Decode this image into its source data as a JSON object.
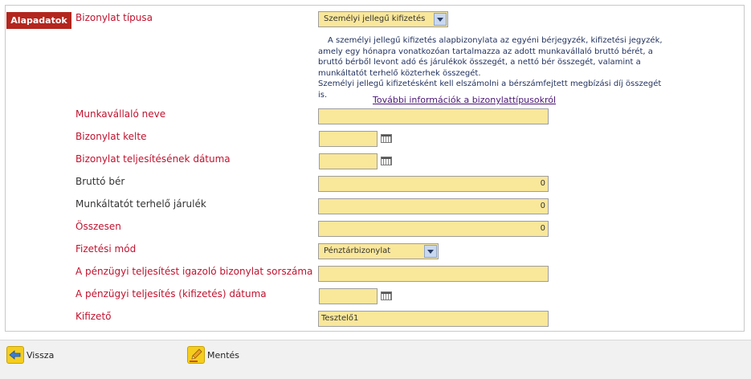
{
  "tab": {
    "label": "Alapadatok"
  },
  "fields": {
    "type": {
      "label": "Bizonylat típusa",
      "value": "Személyi jellegű kifizetés"
    },
    "employee": {
      "label": "Munkavállaló neve",
      "value": ""
    },
    "date": {
      "label": "Bizonylat kelte",
      "value": ""
    },
    "completion_date": {
      "label": "Bizonylat teljesítésének dátuma",
      "value": ""
    },
    "gross": {
      "label": "Bruttó bér",
      "value": "0"
    },
    "contrib": {
      "label": "Munkáltatót terhelő járulék",
      "value": "0"
    },
    "total": {
      "label": "Összesen",
      "value": "0"
    },
    "payment_mode": {
      "label": "Fizetési mód",
      "value": "Pénztárbizonylat"
    },
    "proof_number": {
      "label": "A pénzügyi teljesítést igazoló bizonylat sorszáma",
      "value": ""
    },
    "payment_date": {
      "label": "A pénzügyi teljesítés (kifizetés) dátuma",
      "value": ""
    },
    "payer": {
      "label": "Kifizető",
      "value": "Tesztelő1"
    }
  },
  "description": {
    "line1": "A személyi jellegű kifizetés alapbizonylata az egyéni bérjegyzék, kifizetési jegyzék,",
    "line2": "amely egy hónapra vonatkozóan tartalmazza az adott munkavállaló bruttó bérét, a",
    "line3": "bruttó bérből levont adó és járulékok összegét, a nettó bér összegét, valamint a",
    "line4": "munkáltatót terhelő közterhek összegét.",
    "line5": "Személyi jellegű kifizetésként kell elszámolni a bérszámfejtett megbízási díj összegét is.",
    "more_link": "További információk a bizonylattípusokról"
  },
  "footer": {
    "back_label": "Vissza",
    "save_label": "Mentés"
  },
  "icons": {
    "back": "back-arrow-icon",
    "save": "pencil-icon",
    "calendar": "calendar-icon"
  },
  "colors": {
    "label_red": "#c0122e",
    "input_fill": "#f9e79a",
    "tab_bg": "#b3261e"
  }
}
